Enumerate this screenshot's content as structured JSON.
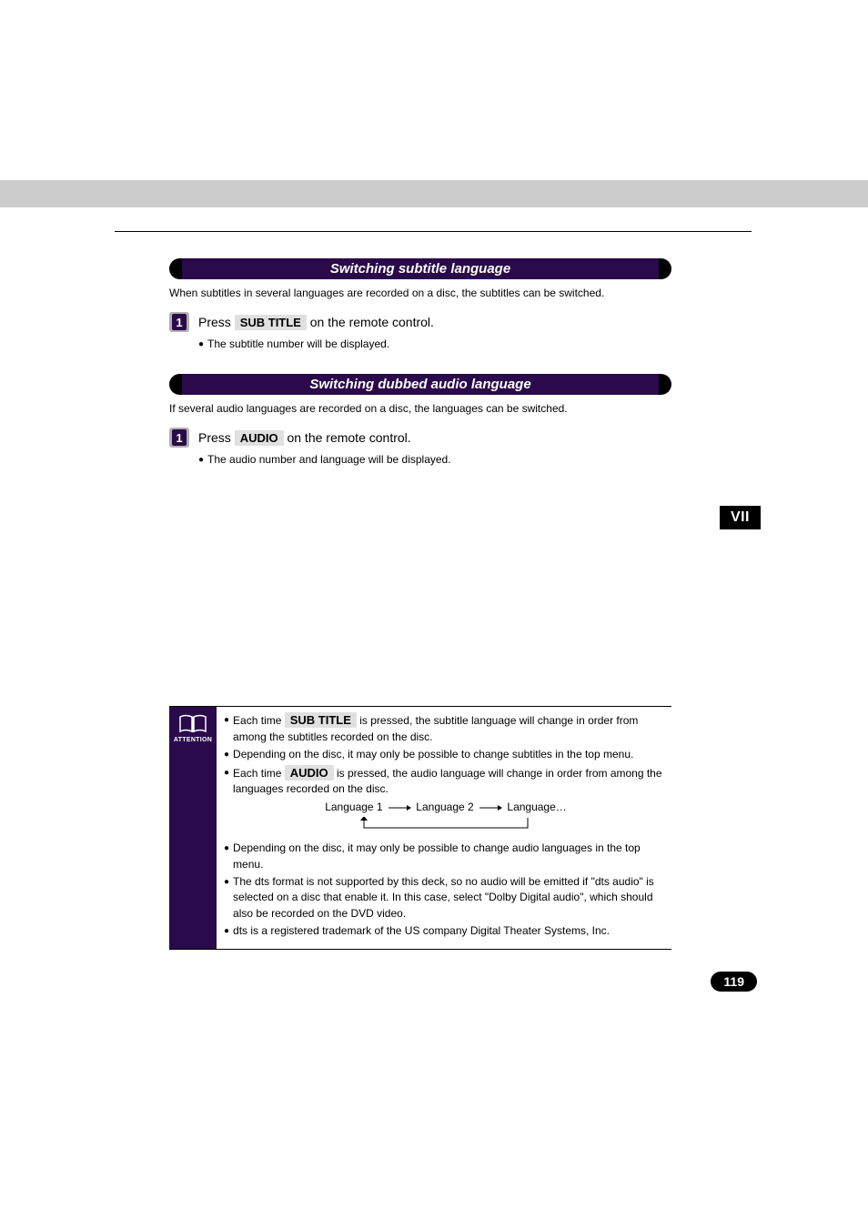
{
  "section1": {
    "title": "Switching subtitle language",
    "intro": "When subtitles in several languages are recorded on a disc, the subtitles can be switched.",
    "step_num": "1",
    "step_pre": "Press ",
    "step_btn": "SUB TITLE",
    "step_post": " on the remote control.",
    "sub": "The subtitle number will be displayed."
  },
  "section2": {
    "title": "Switching dubbed audio language",
    "intro": "If several audio languages are recorded on a disc, the languages can be switched.",
    "step_num": "1",
    "step_pre": "Press ",
    "step_btn": "AUDIO",
    "step_post": " on the remote control.",
    "sub": "The audio number and language will be displayed."
  },
  "side_tab": "VII",
  "attention": {
    "label": "ATTENTION",
    "items": {
      "a": {
        "pre": "Each time ",
        "btn": "SUB TITLE",
        "post": " is pressed, the subtitle language will change in order from among the subtitles recorded on the disc."
      },
      "b": "Depending on the disc, it may only be possible to change subtitles in the top menu.",
      "c": {
        "pre": "Each time ",
        "btn": "AUDIO",
        "post": " is pressed, the audio language will change in order from among the languages recorded on the disc."
      },
      "flow": {
        "l1": "Language 1",
        "l2": "Language 2",
        "l3": "Language…"
      },
      "d": "Depending on the disc, it may only be possible to change audio languages in the top menu.",
      "e": "The dts format is not supported by this deck, so no audio will be emitted if \"dts audio\" is selected on a disc that enable it. In this case, select \"Dolby Digital audio\", which should also be recorded on the DVD video.",
      "f": "dts is a registered trademark of the US company Digital Theater Systems, Inc."
    }
  },
  "page_number": "119"
}
